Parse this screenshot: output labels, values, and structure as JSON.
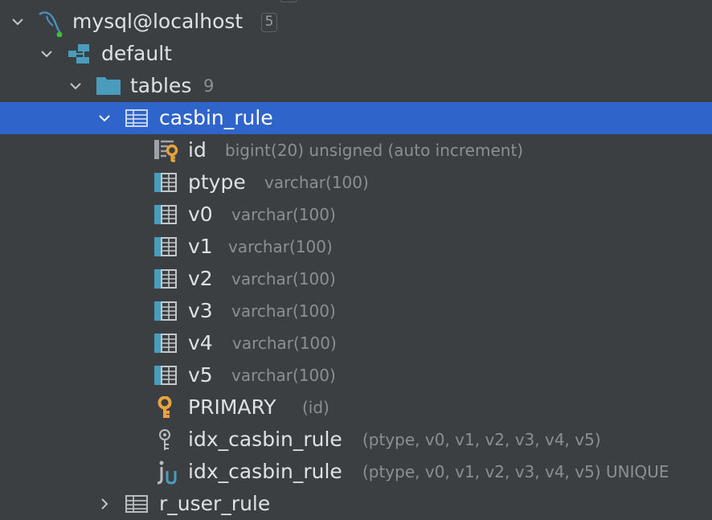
{
  "tree": {
    "connection": {
      "name": "mysql@localhost",
      "badge": "5"
    },
    "schema": {
      "name": "default"
    },
    "folder": {
      "name": "tables",
      "count": "9"
    },
    "table": {
      "name": "casbin_rule"
    },
    "columns": [
      {
        "name": "id",
        "type": "bigint(20) unsigned (auto increment)",
        "icon": "primary-key-column-icon"
      },
      {
        "name": "ptype",
        "type": "varchar(100)",
        "icon": "column-icon"
      },
      {
        "name": "v0",
        "type": "varchar(100)",
        "icon": "column-icon"
      },
      {
        "name": "v1",
        "type": "varchar(100)",
        "icon": "column-icon"
      },
      {
        "name": "v2",
        "type": "varchar(100)",
        "icon": "column-icon"
      },
      {
        "name": "v3",
        "type": "varchar(100)",
        "icon": "column-icon"
      },
      {
        "name": "v4",
        "type": "varchar(100)",
        "icon": "column-icon"
      },
      {
        "name": "v5",
        "type": "varchar(100)",
        "icon": "column-icon"
      }
    ],
    "keys": [
      {
        "name": "PRIMARY",
        "type": "(id)",
        "icon": "primary-key-icon"
      },
      {
        "name": "idx_casbin_rule",
        "type": "(ptype, v0, v1, v2, v3, v4, v5)",
        "icon": "index-key-icon"
      },
      {
        "name": "idx_casbin_rule",
        "type": "(ptype, v0, v1, v2, v3, v4, v5) UNIQUE",
        "icon": "unique-index-icon"
      }
    ],
    "next_table": {
      "name": "r_user_rule"
    }
  },
  "colors": {
    "background": "#3c3f41",
    "selection": "#2f65ca",
    "text": "#dfe1e5",
    "type_text": "#8c8f93",
    "icon_blue": "#4a9cbd",
    "key_gold": "#e8a33d"
  }
}
